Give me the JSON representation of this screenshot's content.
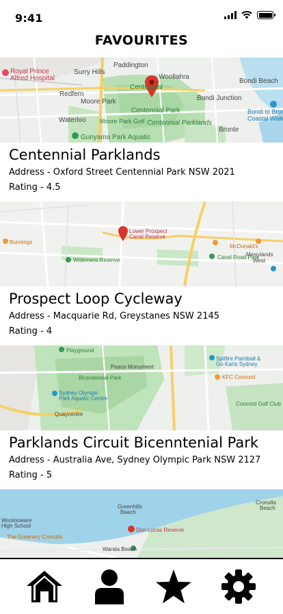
{
  "status": {
    "time": "9:41"
  },
  "header": {
    "title": "FAVOURITES"
  },
  "favourites": [
    {
      "name": "Centennial Parklands",
      "address": "Address - Oxford Street Centennial Park NSW 2021",
      "rating": "Rating    - 4.5",
      "map_labels": [
        "Paddington",
        "Surry Hills",
        "Royal Prince Alfred Hospital",
        "Woollahra",
        "Redfern",
        "Moore Park",
        "Centennial Park",
        "Bondi Junction",
        "Bondi Beach",
        "Waterloo",
        "Moore Park Golf",
        "Centennial Parklands",
        "Gunyama Park Aquatic",
        "Bronte",
        "Bondi to Bronte Coastal Walk"
      ]
    },
    {
      "name": "Prospect Loop Cycleway",
      "address": "Address - Macquarie Rd, Greystanes NSW 2145",
      "rating": "Rating    - 4",
      "map_labels": [
        "Lower Prospect Canal Reserve",
        "Widemere Reserve",
        "Canal Road Park",
        "Merrylands West",
        "Bunnings",
        "McDonald's"
      ]
    },
    {
      "name": "Parklands Circuit Bicenntenial Park",
      "address": "Address - Australia Ave, Sydney Olympic Park NSW 2127",
      "rating": "Rating    - 5",
      "map_labels": [
        "Playground",
        "Bicentennial Park",
        "Peace Monument",
        "Sydney Olympic Park Aquatic Centre",
        "Spitfire Paintball & Go Karts Sydney",
        "Concord Golf Club",
        "KFC Concord",
        "Quaycentre"
      ]
    },
    {
      "name": "",
      "address": "",
      "rating": "",
      "map_labels": [
        "Greenhills Beach",
        "Cronulla Beach",
        "Woolooware High School",
        "Don Lucas Reserve",
        "Wanda Beach",
        "The Greenery Cronulla"
      ]
    }
  ],
  "nav": {
    "items": [
      {
        "icon": "home-icon"
      },
      {
        "icon": "profile-icon"
      },
      {
        "icon": "star-icon"
      },
      {
        "icon": "gear-icon"
      }
    ]
  }
}
